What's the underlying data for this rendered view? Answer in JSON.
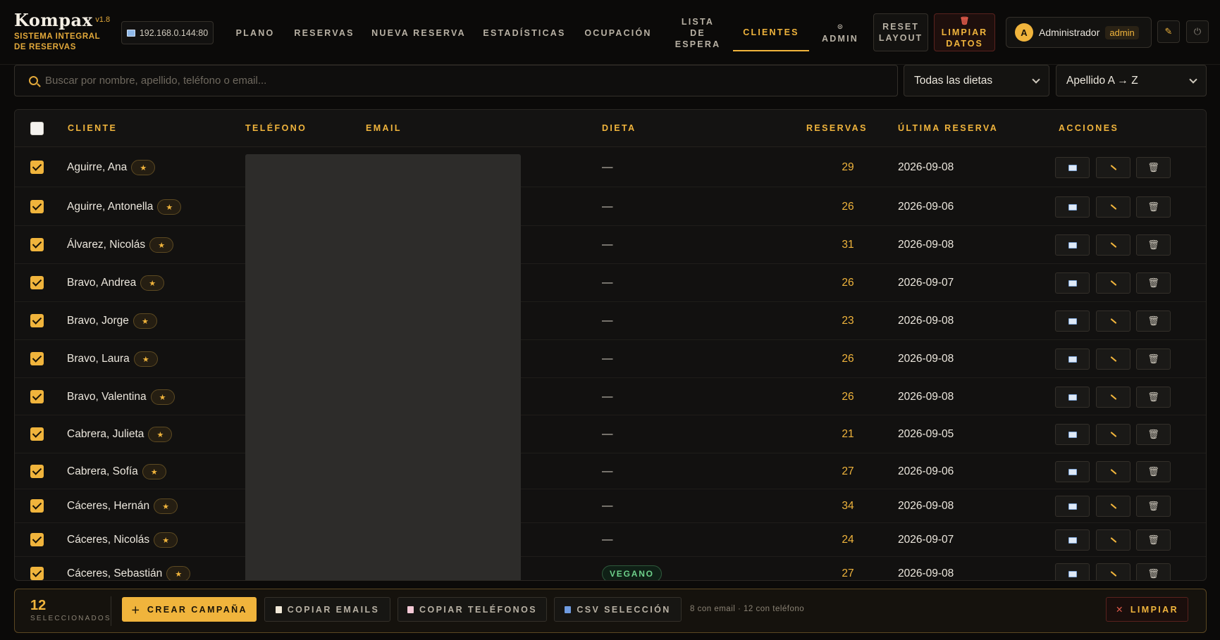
{
  "brand": {
    "name": "Kompax",
    "version": "v1.8",
    "subtitle_line1": "SISTEMA INTEGRAL",
    "subtitle_line2": "DE RESERVAS"
  },
  "host": {
    "ip": "192.168.0.144:80",
    "icon": "monitor-icon"
  },
  "nav": {
    "plano": "PLANO",
    "reservas": "RESERVAS",
    "nueva_reserva": "NUEVA RESERVA",
    "estadisticas": "ESTADÍSTICAS",
    "ocupacion": "OCUPACIÓN",
    "lista_line1": "LISTA",
    "lista_line2": "DE ESPERA",
    "clientes": "CLIENTES",
    "admin": "ADMIN",
    "admin_icon": "⊙",
    "active": "clientes"
  },
  "actions": {
    "reset_line1": "RESET",
    "reset_line2": "LAYOUT",
    "limpiar_line1": "LIMPIAR",
    "limpiar_line2": "DATOS"
  },
  "user": {
    "initial": "A",
    "name": "Administrador",
    "role": "admin"
  },
  "filters": {
    "search_placeholder": "Buscar por nombre, apellido, teléfono o email...",
    "diet_select": "Todas las dietas",
    "sort_select": "Apellido A → Z"
  },
  "table": {
    "headers": {
      "cliente": "CLIENTE",
      "telefono": "TELÉFONO",
      "email": "EMAIL",
      "dieta": "DIETA",
      "reservas": "RESERVAS",
      "ultima": "ÚLTIMA RESERVA",
      "acciones": "ACCIONES"
    },
    "rows": [
      {
        "name": "Aguirre, Ana",
        "diet": "—",
        "reservas": "29",
        "last": "2026-09-08",
        "checked": true
      },
      {
        "name": "Aguirre, Antonella",
        "diet": "—",
        "reservas": "26",
        "last": "2026-09-06",
        "checked": true
      },
      {
        "name": "Álvarez, Nicolás",
        "diet": "—",
        "reservas": "31",
        "last": "2026-09-08",
        "checked": true
      },
      {
        "name": "Bravo, Andrea",
        "diet": "—",
        "reservas": "26",
        "last": "2026-09-07",
        "checked": true
      },
      {
        "name": "Bravo, Jorge",
        "diet": "—",
        "reservas": "23",
        "last": "2026-09-08",
        "checked": true
      },
      {
        "name": "Bravo, Laura",
        "diet": "—",
        "reservas": "26",
        "last": "2026-09-08",
        "checked": true
      },
      {
        "name": "Bravo, Valentina",
        "diet": "—",
        "reservas": "26",
        "last": "2026-09-08",
        "checked": true
      },
      {
        "name": "Cabrera, Julieta",
        "diet": "—",
        "reservas": "21",
        "last": "2026-09-05",
        "checked": true
      },
      {
        "name": "Cabrera, Sofía",
        "diet": "—",
        "reservas": "27",
        "last": "2026-09-06",
        "checked": true
      },
      {
        "name": "Cáceres, Hernán",
        "diet": "—",
        "reservas": "34",
        "last": "2026-09-08",
        "checked": true
      },
      {
        "name": "Cáceres, Nicolás",
        "diet": "—",
        "reservas": "24",
        "last": "2026-09-07",
        "checked": true
      },
      {
        "name": "Cáceres, Sebastián",
        "diet": "VEGANO",
        "reservas": "27",
        "last": "2026-09-08",
        "checked": true
      }
    ]
  },
  "selection": {
    "count": "12",
    "label": "SELECCIONADOS",
    "crear_campana": "CREAR CAMPAÑA",
    "copiar_emails": "COPIAR EMAILS",
    "copiar_telefonos": "COPIAR TELÉFONOS",
    "csv_seleccion": "CSV SELECCIÓN",
    "summary": "8 con email · 12 con teléfono",
    "limpiar": "LIMPIAR"
  },
  "colors": {
    "accent": "#f0b43c",
    "danger": "#e05a4a",
    "vegan": "#6dcf8a",
    "background": "#0b0a09"
  }
}
